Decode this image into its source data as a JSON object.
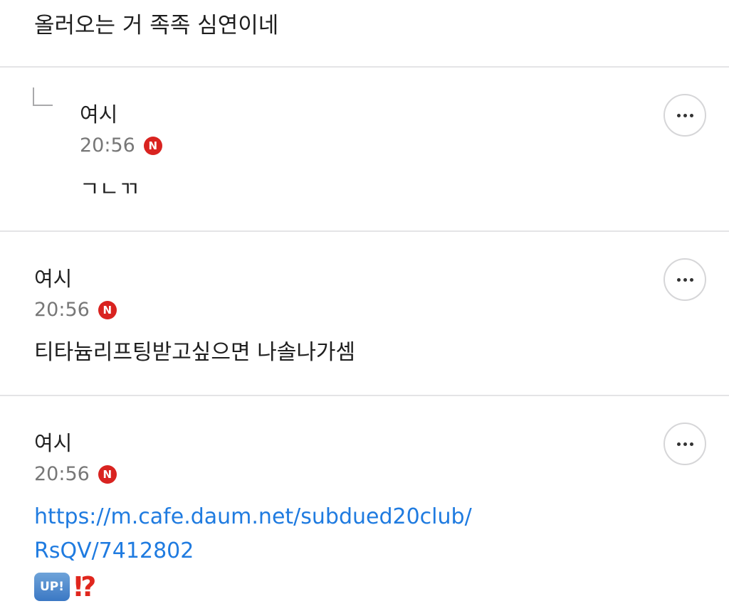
{
  "top_text": "올러오는 거 족족 심연이네",
  "badge_new": "N",
  "comments": [
    {
      "author": "여시",
      "time": "20:56",
      "text": "ㄱㄴㄲ",
      "is_reply": true
    },
    {
      "author": "여시",
      "time": "20:56",
      "text": "티타늄리프팅받고싶으면 나솔나가셈",
      "is_reply": false
    },
    {
      "author": "여시",
      "time": "20:56",
      "link": "https://m.cafe.daum.net/subdued20club/RsQV/7412802",
      "link_line1": "https://m.cafe.daum.net/subdued20club/",
      "link_line2": "RsQV/7412802",
      "emoji_up": "UP!",
      "emoji_interrobang": "⁉",
      "is_reply": false
    }
  ],
  "icons": {
    "more": "more-options-icon",
    "reply": "reply-arrow-icon",
    "new": "new-badge-icon"
  },
  "colors": {
    "link": "#1f7be0",
    "new_badge": "#d92320",
    "divider": "#e4e4e6"
  }
}
